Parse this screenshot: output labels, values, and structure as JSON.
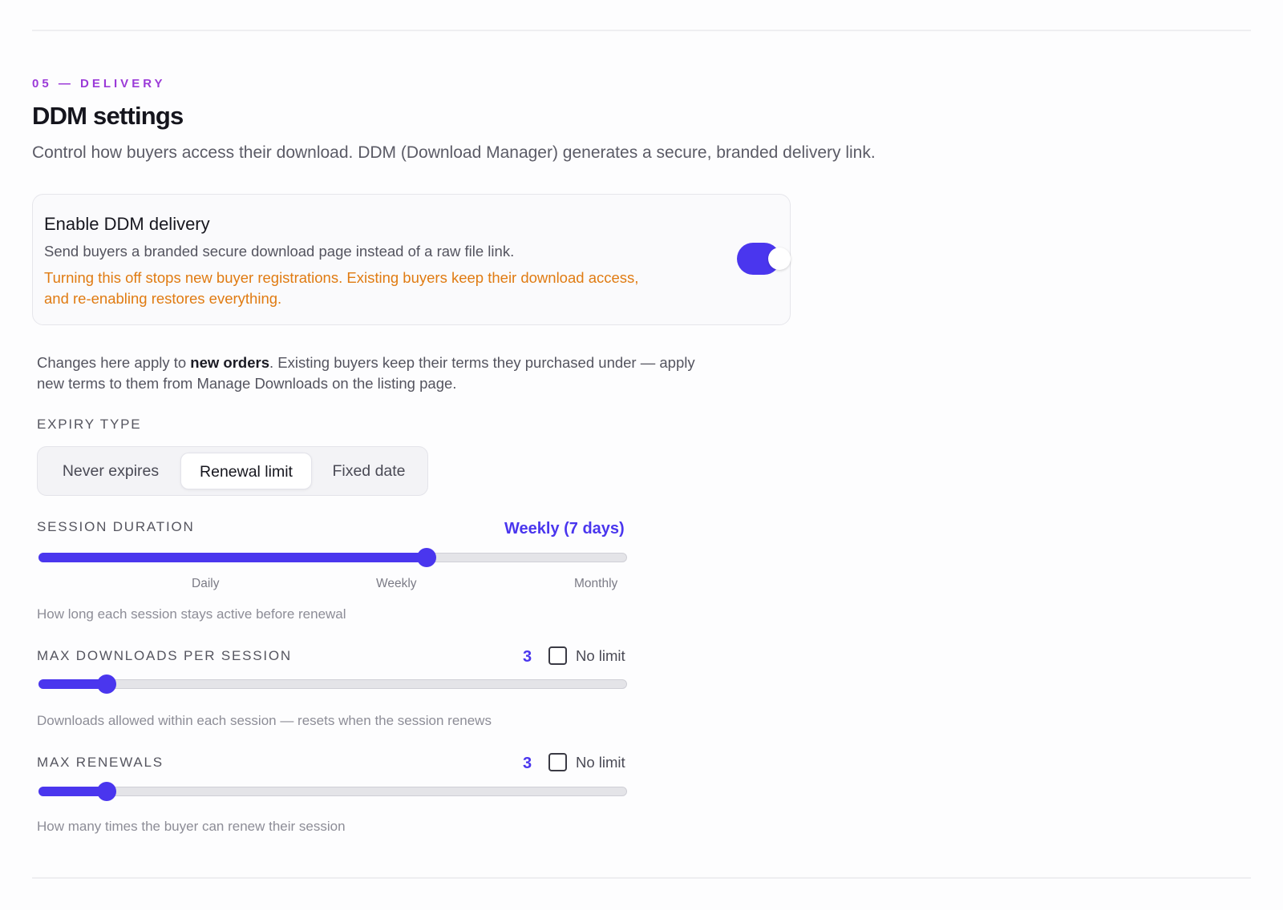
{
  "section": {
    "eyebrow": "05 — DELIVERY",
    "title": "DDM settings",
    "subtitle": "Control how buyers access their download. DDM (Download Manager) generates a secure, branded delivery link."
  },
  "enable_card": {
    "title": "Enable DDM delivery",
    "description": "Send buyers a branded secure download page instead of a raw file link.",
    "warning_line1": "Turning this off stops new buyer registrations. Existing buyers keep their download access,",
    "warning_line2": "and re-enabling restores everything.",
    "enabled": true
  },
  "note": {
    "prefix": "Changes here apply to ",
    "bold": "new orders",
    "suffix_line1": ". Existing buyers keep their terms they purchased under — apply",
    "line2": "new terms to them from Manage Downloads on the listing page."
  },
  "expiry": {
    "label": "EXPIRY TYPE",
    "options": [
      "Never expires",
      "Renewal limit",
      "Fixed date"
    ],
    "selected": "Renewal limit"
  },
  "session_duration": {
    "label": "SESSION DURATION",
    "value_label": "Weekly (7 days)",
    "fraction": 0.66,
    "ticks": [
      "Daily",
      "Weekly",
      "Monthly"
    ],
    "hint": "How long each session stays active before renewal"
  },
  "max_downloads": {
    "label": "MAX DOWNLOADS PER SESSION",
    "value": "3",
    "fraction": 0.115,
    "no_limit_label": "No limit",
    "no_limit_checked": false,
    "hint": "Downloads allowed within each session — resets when the session renews"
  },
  "max_renewals": {
    "label": "MAX RENEWALS",
    "value": "3",
    "fraction": 0.115,
    "no_limit_label": "No limit",
    "no_limit_checked": false,
    "hint": "How many times the buyer can renew their session"
  },
  "colors": {
    "accent": "#4a36ee",
    "eyebrow": "#9b3ad8",
    "warning": "#e07b12"
  }
}
